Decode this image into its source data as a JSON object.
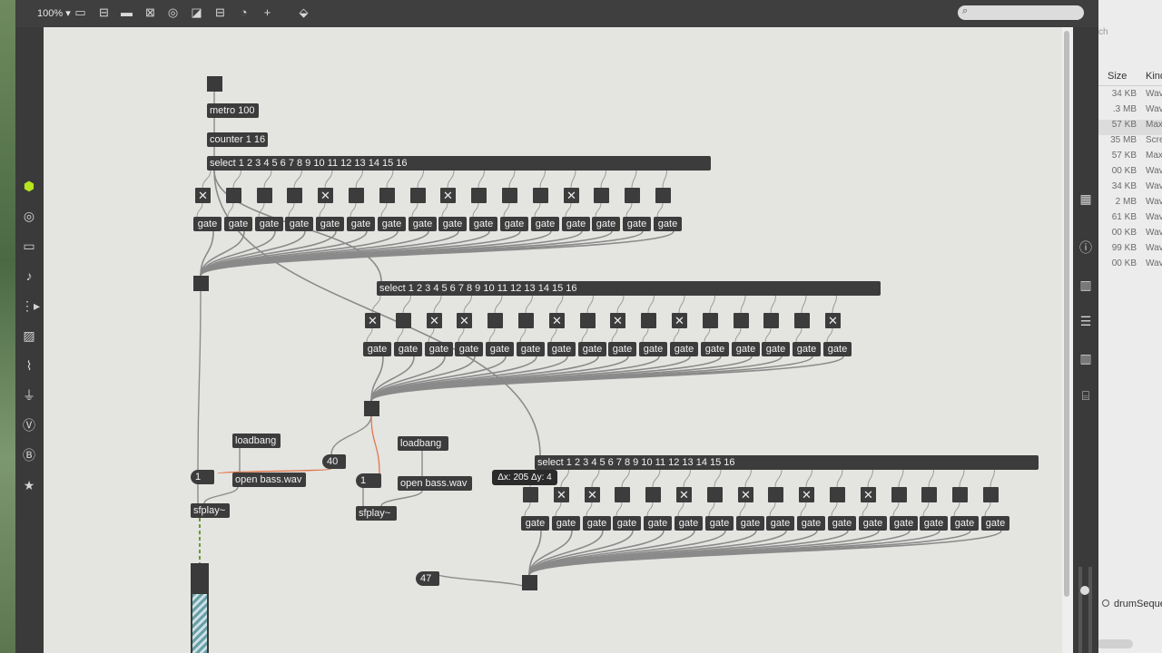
{
  "toolbar": {
    "zoom": "100%",
    "icons": [
      "presentation-icon",
      "comment-icon",
      "message-icon",
      "toggle-icon",
      "button-icon",
      "inlet-icon",
      "slider-icon",
      "dial-icon",
      "plus-icon",
      "paint-icon"
    ]
  },
  "sidebar_left": {
    "icons": [
      "package-icon",
      "target-icon",
      "video-icon",
      "music-note-icon",
      "sequence-icon",
      "image-icon",
      "attachment-icon",
      "plug-icon",
      "vimeo-icon",
      "brush-icon",
      "star-icon"
    ]
  },
  "patch": {
    "metro": "metro 100",
    "counter": "counter 1 16",
    "select": "select 1 2 3 4 5 6 7 8 9 10 11 12 13 14 15 16",
    "gate": "gate",
    "loadbang": "loadbang",
    "open_msg": "open bass.wav",
    "sfplay": "sfplay~",
    "num_left": "1",
    "num_mid": "1",
    "num_40": "40",
    "num_47": "47",
    "tooltip": "Δx: 205 Δy: 4",
    "row1_toggles": [
      1,
      0,
      0,
      0,
      1,
      0,
      0,
      0,
      1,
      0,
      0,
      0,
      1,
      0,
      0,
      0
    ],
    "row2_toggles": [
      1,
      0,
      1,
      1,
      0,
      0,
      1,
      0,
      1,
      0,
      1,
      0,
      0,
      0,
      0,
      1
    ],
    "row3_toggles": [
      0,
      1,
      1,
      0,
      0,
      1,
      0,
      1,
      0,
      1,
      0,
      1,
      0,
      0,
      0,
      0
    ]
  },
  "finder": {
    "search_placeholder": "ch",
    "col_size": "Size",
    "col_kind": "Kind",
    "rows": [
      {
        "size": "34 KB",
        "kind": "Wav"
      },
      {
        "size": ".3 MB",
        "kind": "Wav"
      },
      {
        "size": "57 KB",
        "kind": "Max"
      },
      {
        "size": "35 MB",
        "kind": "Scre"
      },
      {
        "size": "57 KB",
        "kind": "Max"
      },
      {
        "size": "00 KB",
        "kind": "Wav"
      },
      {
        "size": "34 KB",
        "kind": "Wav"
      },
      {
        "size": "2 MB",
        "kind": "Wav"
      },
      {
        "size": "61 KB",
        "kind": "Wav"
      },
      {
        "size": "00 KB",
        "kind": "Wav"
      },
      {
        "size": "99 KB",
        "kind": "Wav"
      },
      {
        "size": "00 KB",
        "kind": "Wav"
      }
    ],
    "file_label": "drumSeque"
  },
  "colors": {
    "canvas": "#e4e4e1",
    "object": "#3c3c3c",
    "patch_cord": "#8c8c8c",
    "selected_cord": "#e07040"
  }
}
